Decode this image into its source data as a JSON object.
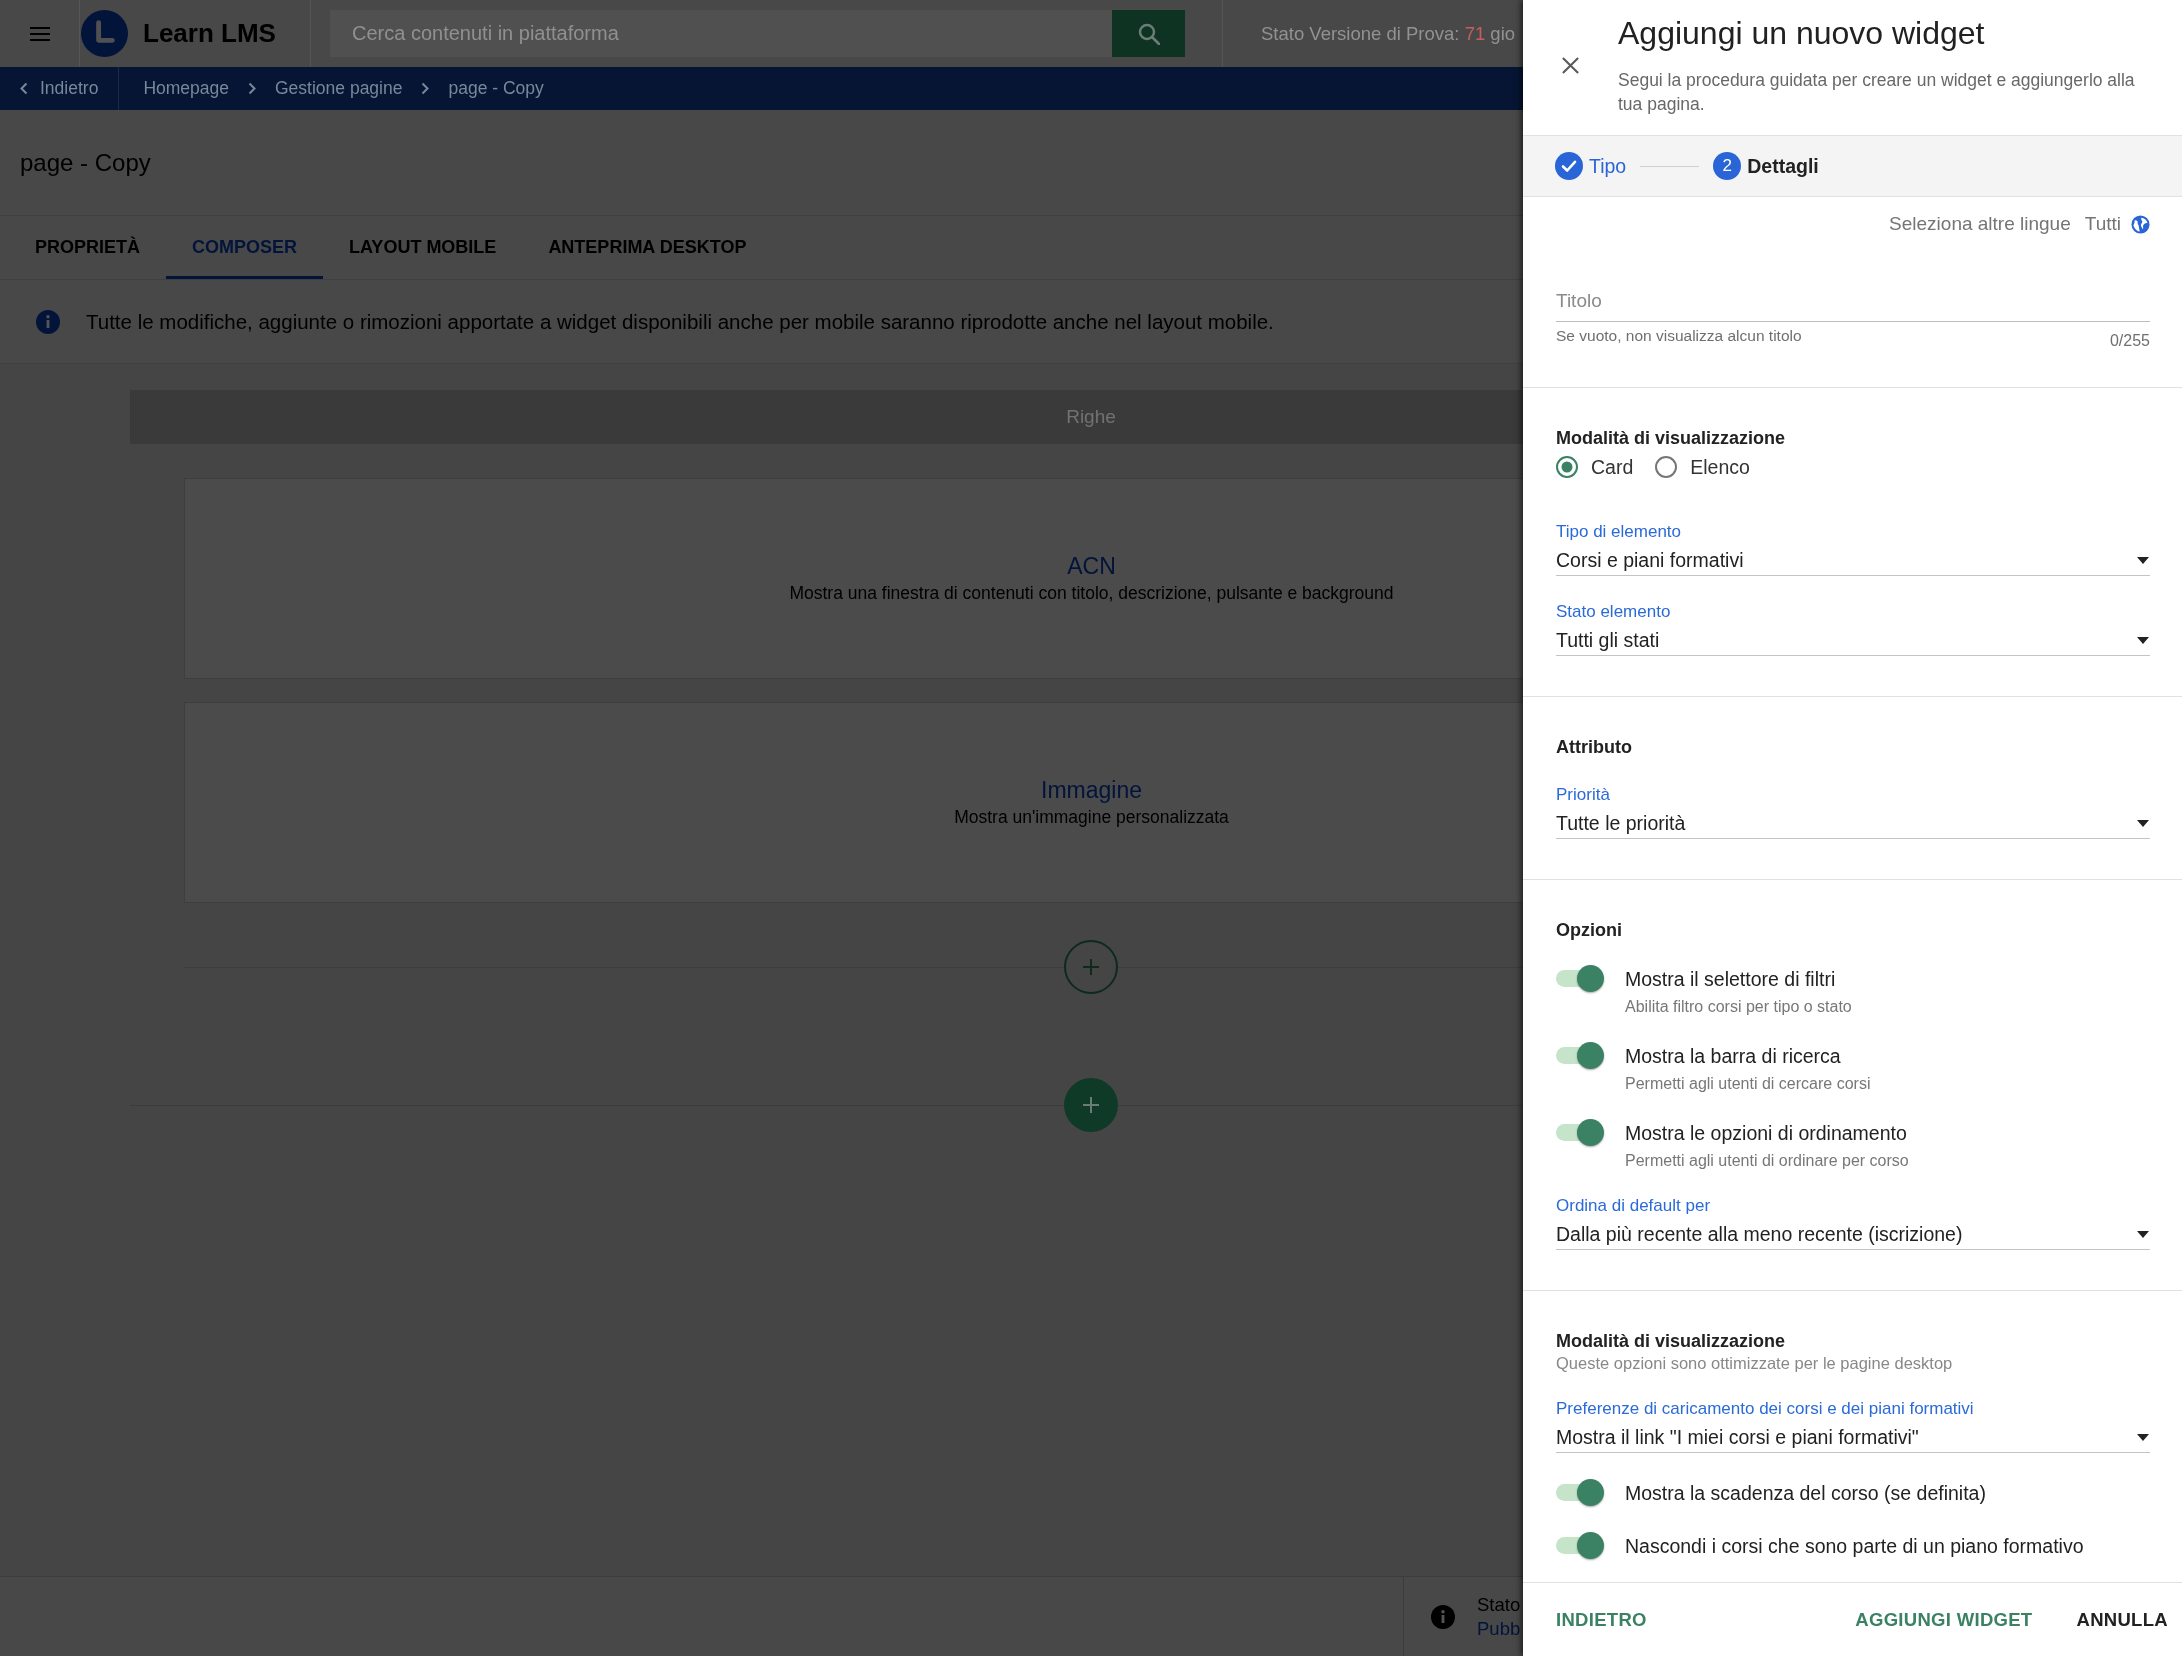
{
  "header": {
    "app_name": "Learn LMS",
    "search": {
      "placeholder": "Cerca contenuti in piattaforma"
    },
    "trial_status": {
      "label": "Stato Versione di Prova:",
      "days": "71",
      "unit": "gio"
    }
  },
  "breadcrumb": {
    "back": "Indietro",
    "items": [
      "Homepage",
      "Gestione pagine",
      "page - Copy"
    ]
  },
  "page": {
    "title": "page - Copy",
    "tabs": [
      {
        "label": "PROPRIETÀ",
        "selected": false
      },
      {
        "label": "COMPOSER",
        "selected": true
      },
      {
        "label": "LAYOUT MOBILE",
        "selected": false
      },
      {
        "label": "ANTEPRIMA DESKTOP",
        "selected": false
      }
    ],
    "info_message": "Tutte le modifiche, aggiunte o rimozioni apportate a widget disponibili anche per mobile saranno riprodotte anche nel layout mobile.",
    "rows_header": "Righe",
    "widgets": [
      {
        "title": "ACN",
        "description": "Mostra una finestra di contenuti con titolo, descrizione, pulsante e background"
      },
      {
        "title": "Immagine",
        "description": "Mostra un'immagine personalizzata"
      }
    ],
    "status": {
      "label": "Stato",
      "value": "Pubb"
    }
  },
  "drawer": {
    "title": "Aggiungi un nuovo widget",
    "subtitle": "Segui la procedura guidata per creare un widget e aggiungerlo alla tua pagina.",
    "steps": [
      {
        "label": "Tipo",
        "completed": true,
        "selected": false
      },
      {
        "number": "2",
        "label": "Dettagli",
        "completed": false,
        "selected": true
      }
    ],
    "language": {
      "label": "Seleziona altre lingue",
      "value": "Tutti"
    },
    "title_field": {
      "placeholder": "Titolo",
      "helper": "Se vuoto, non visualizza alcun titolo",
      "counter": "0/255"
    },
    "sections": [
      {
        "heading": "Modalità di visualizzazione",
        "controls": [
          {
            "kind": "radio_group",
            "options": [
              {
                "label": "Card",
                "selected": true
              },
              {
                "label": "Elenco",
                "selected": false
              }
            ]
          },
          {
            "kind": "select",
            "label": "Tipo di elemento",
            "value": "Corsi e piani formativi"
          },
          {
            "kind": "select",
            "label": "Stato elemento",
            "value": "Tutti gli stati"
          }
        ]
      },
      {
        "heading": "Attributo",
        "controls": [
          {
            "kind": "select",
            "label": "Priorità",
            "value": "Tutte le priorità"
          }
        ]
      },
      {
        "heading": "Opzioni",
        "controls": [
          {
            "kind": "toggle",
            "label": "Mostra il selettore di filtri",
            "hint": "Abilita filtro corsi per tipo o stato",
            "on": true
          },
          {
            "kind": "toggle",
            "label": "Mostra la barra di ricerca",
            "hint": "Permetti agli utenti di cercare corsi",
            "on": true
          },
          {
            "kind": "toggle",
            "label": "Mostra le opzioni di ordinamento",
            "hint": "Permetti agli utenti di ordinare per corso",
            "on": true
          },
          {
            "kind": "select",
            "label": "Ordina di default per",
            "value": "Dalla più recente alla meno recente (iscrizione)"
          }
        ]
      },
      {
        "heading": "Modalità di visualizzazione",
        "subheading": "Queste opzioni sono ottimizzate per le pagine desktop",
        "controls": [
          {
            "kind": "select",
            "label": "Preferenze di caricamento dei corsi e dei piani formativi",
            "value": "Mostra il link \"I miei corsi e piani formativi\""
          },
          {
            "kind": "toggle",
            "label": "Mostra la scadenza del corso (se definita)",
            "on": true
          },
          {
            "kind": "toggle",
            "label": "Nascondi i corsi che sono parte di un piano formativo",
            "on": true
          }
        ]
      }
    ],
    "buttons": [
      {
        "label": "INDIETRO",
        "kind": "back"
      },
      {
        "label": "AGGIUNGI WIDGET",
        "kind": "confirm"
      },
      {
        "label": "ANNULLA",
        "kind": "cancel"
      }
    ]
  }
}
